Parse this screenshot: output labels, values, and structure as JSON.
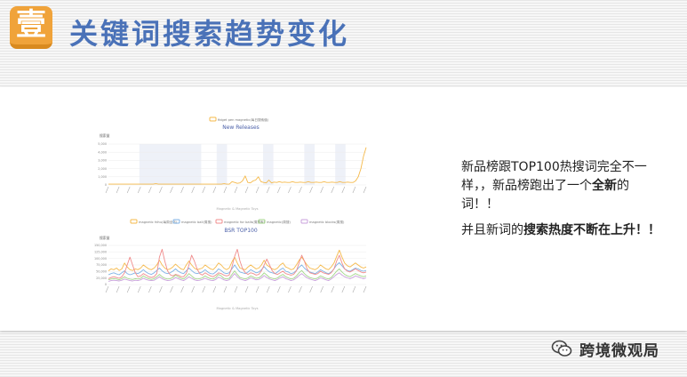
{
  "header": {
    "badge_char": "壹",
    "title": "关键词搜索趋势变化"
  },
  "charts": [
    {
      "id": "new-releases",
      "legend": [
        "fidget pen magnetic(每日搜索值)"
      ],
      "title": "New Releases",
      "ylabel": "搜索量",
      "xlabel": "Magnetic & Magnetic Toys",
      "yticks": [
        "5,000",
        "4,000",
        "3,000",
        "2,000",
        "1,000",
        "0"
      ],
      "colors": [
        "#f5b94a"
      ],
      "bands": [
        [
          0.12,
          0.36
        ],
        [
          0.42,
          0.46
        ],
        [
          0.6,
          0.64
        ],
        [
          0.76,
          0.8
        ],
        [
          0.88,
          0.92
        ]
      ],
      "series": [
        {
          "values": [
            0.02,
            0.02,
            0.02,
            0.02,
            0.02,
            0.02,
            0.02,
            0.02,
            0.02,
            0.02,
            0.02,
            0.02,
            0.02,
            0.02,
            0.02,
            0.02,
            0.02,
            0.02,
            0.03,
            0.02,
            0.02,
            0.02,
            0.02,
            0.02,
            0.02,
            0.02,
            0.02,
            0.02,
            0.02,
            0.02,
            0.02,
            0.02,
            0.02,
            0.02,
            0.02,
            0.02,
            0.02,
            0.02,
            0.02,
            0.02,
            0.02,
            0.02,
            0.02,
            0.02,
            0.03,
            0.02,
            0.02,
            0.08,
            0.06,
            0.04,
            0.05,
            0.1,
            0.22,
            0.06,
            0.05,
            0.1,
            0.12,
            0.2,
            0.08,
            0.06,
            0.05,
            0.12,
            0.05,
            0.07,
            0.06,
            0.08,
            0.06,
            0.07,
            0.06,
            0.06,
            0.08,
            0.06,
            0.06,
            0.07,
            0.06,
            0.06,
            0.08,
            0.06,
            0.06,
            0.07,
            0.06,
            0.06,
            0.08,
            0.06,
            0.06,
            0.07,
            0.06,
            0.06,
            0.08,
            0.06,
            0.06,
            0.07,
            0.06,
            0.06,
            0.1,
            0.2,
            0.4,
            0.7,
            0.92
          ]
        }
      ]
    },
    {
      "id": "bsr-top100",
      "legend": [
        "magnetic fdhu(每周全站)",
        "magnetic ball(周搜)",
        "magnetic for balls(周搜索)",
        "magnetic(周搜)",
        "magnetic blocks(周搜)"
      ],
      "title": "BSR TOP100",
      "ylabel": "搜索量",
      "xlabel": "Magnetic & Magnetic Toys",
      "yticks": [
        "150,000",
        "125,000",
        "100,000",
        "75,000",
        "50,000",
        "25,000",
        "0"
      ],
      "colors": [
        "#f5b94a",
        "#7fb2e5",
        "#f08c8c",
        "#a4d68b",
        "#c9a0dc"
      ],
      "bands": [],
      "series": [
        {
          "values": [
            0.35,
            0.4,
            0.38,
            0.42,
            0.36,
            0.4,
            0.55,
            0.45,
            0.38,
            0.36,
            0.4,
            0.38,
            0.42,
            0.5,
            0.45,
            0.4,
            0.38,
            0.42,
            0.5,
            0.62,
            0.5,
            0.42,
            0.38,
            0.4,
            0.45,
            0.52,
            0.46,
            0.4,
            0.38,
            0.5,
            0.6,
            0.5,
            0.42,
            0.38,
            0.4,
            0.42,
            0.5,
            0.45,
            0.4,
            0.38,
            0.45,
            0.55,
            0.5,
            0.42,
            0.38,
            0.42,
            0.58,
            0.7,
            0.55,
            0.42,
            0.4,
            0.38,
            0.45,
            0.5,
            0.45,
            0.4,
            0.42,
            0.5,
            0.62,
            0.5,
            0.45,
            0.4,
            0.38,
            0.42,
            0.5,
            0.55,
            0.45,
            0.42,
            0.38,
            0.4,
            0.5,
            0.62,
            0.7,
            0.6,
            0.5,
            0.42,
            0.4,
            0.38,
            0.42,
            0.5,
            0.45,
            0.4,
            0.38,
            0.45,
            0.55,
            0.72,
            0.88,
            0.7,
            0.55,
            0.48,
            0.45,
            0.5,
            0.55,
            0.5,
            0.45,
            0.42,
            0.45
          ]
        },
        {
          "values": [
            0.25,
            0.28,
            0.3,
            0.27,
            0.25,
            0.3,
            0.35,
            0.28,
            0.25,
            0.27,
            0.3,
            0.28,
            0.32,
            0.38,
            0.32,
            0.28,
            0.26,
            0.3,
            0.36,
            0.42,
            0.35,
            0.3,
            0.28,
            0.3,
            0.34,
            0.4,
            0.34,
            0.3,
            0.28,
            0.35,
            0.42,
            0.36,
            0.3,
            0.28,
            0.3,
            0.32,
            0.38,
            0.32,
            0.28,
            0.27,
            0.32,
            0.4,
            0.36,
            0.3,
            0.28,
            0.3,
            0.4,
            0.5,
            0.4,
            0.32,
            0.3,
            0.28,
            0.32,
            0.38,
            0.34,
            0.3,
            0.32,
            0.38,
            0.46,
            0.38,
            0.32,
            0.3,
            0.28,
            0.32,
            0.38,
            0.42,
            0.34,
            0.32,
            0.28,
            0.3,
            0.36,
            0.44,
            0.5,
            0.42,
            0.36,
            0.32,
            0.3,
            0.28,
            0.32,
            0.38,
            0.34,
            0.3,
            0.28,
            0.32,
            0.4,
            0.5,
            0.56,
            0.48,
            0.4,
            0.36,
            0.34,
            0.38,
            0.42,
            0.4,
            0.36,
            0.34,
            0.36
          ]
        },
        {
          "values": [
            0.15,
            0.18,
            0.2,
            0.18,
            0.16,
            0.2,
            0.3,
            0.5,
            0.7,
            0.5,
            0.3,
            0.2,
            0.22,
            0.28,
            0.24,
            0.2,
            0.18,
            0.2,
            0.28,
            0.7,
            0.9,
            0.6,
            0.35,
            0.25,
            0.22,
            0.26,
            0.24,
            0.2,
            0.2,
            0.28,
            0.5,
            0.75,
            0.6,
            0.4,
            0.28,
            0.24,
            0.3,
            0.26,
            0.22,
            0.2,
            0.24,
            0.3,
            0.28,
            0.24,
            0.22,
            0.24,
            0.45,
            0.72,
            0.9,
            0.6,
            0.4,
            0.3,
            0.26,
            0.3,
            0.28,
            0.24,
            0.26,
            0.35,
            0.5,
            0.65,
            0.5,
            0.35,
            0.28,
            0.26,
            0.3,
            0.34,
            0.28,
            0.26,
            0.24,
            0.26,
            0.35,
            0.55,
            0.75,
            0.6,
            0.4,
            0.3,
            0.28,
            0.26,
            0.28,
            0.34,
            0.3,
            0.28,
            0.26,
            0.3,
            0.4,
            0.6,
            0.75,
            0.55,
            0.4,
            0.34,
            0.32,
            0.36,
            0.4,
            0.36,
            0.32,
            0.3,
            0.32
          ]
        },
        {
          "values": [
            0.12,
            0.14,
            0.15,
            0.14,
            0.12,
            0.15,
            0.2,
            0.16,
            0.14,
            0.13,
            0.15,
            0.14,
            0.16,
            0.22,
            0.18,
            0.15,
            0.13,
            0.15,
            0.2,
            0.26,
            0.2,
            0.16,
            0.14,
            0.15,
            0.18,
            0.24,
            0.2,
            0.16,
            0.14,
            0.2,
            0.28,
            0.22,
            0.16,
            0.14,
            0.15,
            0.17,
            0.22,
            0.18,
            0.15,
            0.14,
            0.18,
            0.26,
            0.22,
            0.16,
            0.14,
            0.16,
            0.26,
            0.35,
            0.26,
            0.18,
            0.16,
            0.14,
            0.17,
            0.22,
            0.19,
            0.16,
            0.17,
            0.22,
            0.3,
            0.24,
            0.18,
            0.16,
            0.14,
            0.17,
            0.22,
            0.26,
            0.2,
            0.17,
            0.14,
            0.16,
            0.22,
            0.3,
            0.36,
            0.28,
            0.22,
            0.18,
            0.16,
            0.14,
            0.17,
            0.22,
            0.19,
            0.16,
            0.14,
            0.18,
            0.26,
            0.34,
            0.4,
            0.32,
            0.26,
            0.22,
            0.2,
            0.24,
            0.28,
            0.25,
            0.22,
            0.2,
            0.22
          ]
        },
        {
          "values": [
            0.08,
            0.1,
            0.11,
            0.1,
            0.09,
            0.11,
            0.14,
            0.12,
            0.1,
            0.09,
            0.11,
            0.1,
            0.12,
            0.16,
            0.13,
            0.11,
            0.1,
            0.11,
            0.15,
            0.2,
            0.15,
            0.12,
            0.1,
            0.11,
            0.13,
            0.18,
            0.15,
            0.12,
            0.1,
            0.14,
            0.2,
            0.16,
            0.12,
            0.1,
            0.11,
            0.13,
            0.16,
            0.13,
            0.11,
            0.1,
            0.13,
            0.19,
            0.16,
            0.12,
            0.1,
            0.12,
            0.2,
            0.28,
            0.2,
            0.14,
            0.12,
            0.1,
            0.13,
            0.17,
            0.15,
            0.12,
            0.13,
            0.17,
            0.23,
            0.18,
            0.14,
            0.12,
            0.1,
            0.13,
            0.17,
            0.2,
            0.15,
            0.13,
            0.1,
            0.12,
            0.17,
            0.23,
            0.28,
            0.22,
            0.17,
            0.14,
            0.12,
            0.1,
            0.13,
            0.17,
            0.15,
            0.12,
            0.1,
            0.14,
            0.2,
            0.26,
            0.3,
            0.24,
            0.2,
            0.17,
            0.15,
            0.18,
            0.22,
            0.2,
            0.17,
            0.15,
            0.17
          ]
        }
      ]
    }
  ],
  "text": {
    "p1_a": "新品榜跟TOP100热搜词完全不一样，，新品榜跑出了一个",
    "p1_b": "全新",
    "p1_c": "的词！！",
    "p2_a": "并且新词的",
    "p2_b": "搜索热度不断在上升",
    "p2_c": "！！"
  },
  "watermark": {
    "icon": "wechat-icon",
    "text": "跨境微观局"
  }
}
